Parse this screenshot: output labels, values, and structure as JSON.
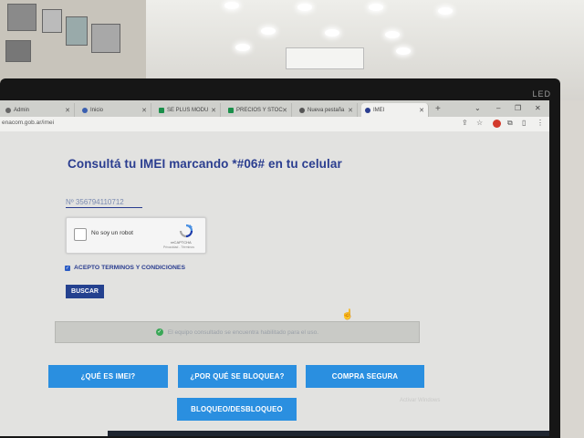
{
  "browser": {
    "tabs": [
      {
        "label": "Admin",
        "active": false
      },
      {
        "label": "Inicio",
        "active": false
      },
      {
        "label": "SE PLUS MODU",
        "active": false
      },
      {
        "label": "PRECIOS Y STOC",
        "active": false
      },
      {
        "label": "Nueva pestaña",
        "active": false
      },
      {
        "label": "IMEI",
        "active": true
      }
    ],
    "url": "enacom.gob.ar/imei"
  },
  "monitor": {
    "brand": "LED"
  },
  "page": {
    "heading": "Consultá tu IMEI marcando *#06# en tu celular",
    "imei_value": "Nº 356794110712",
    "captcha": {
      "label": "No soy un robot",
      "brand": "reCAPTCHA",
      "terms": "Privacidad - Términos"
    },
    "accept_label": "ACEPTO TERMINOS Y CONDICIONES",
    "accept_checked": true,
    "search_button": "BUSCAR",
    "result_message": "El equipo consultado se encuentra habilitado para el uso.",
    "buttons": {
      "what_is_imei": "¿QUÉ ES IMEI?",
      "why_blocked": "¿POR QUÉ SE BLOQUEA?",
      "safe_purchase": "COMPRA SEGURA",
      "block_unblock": "BLOQUEO/DESBLOQUEO"
    },
    "watermark": "Activar Windows"
  },
  "colors": {
    "heading": "#2a3d8f",
    "nav_button": "#2a8fe0",
    "search_button": "#24418f",
    "success": "#3aa757"
  }
}
